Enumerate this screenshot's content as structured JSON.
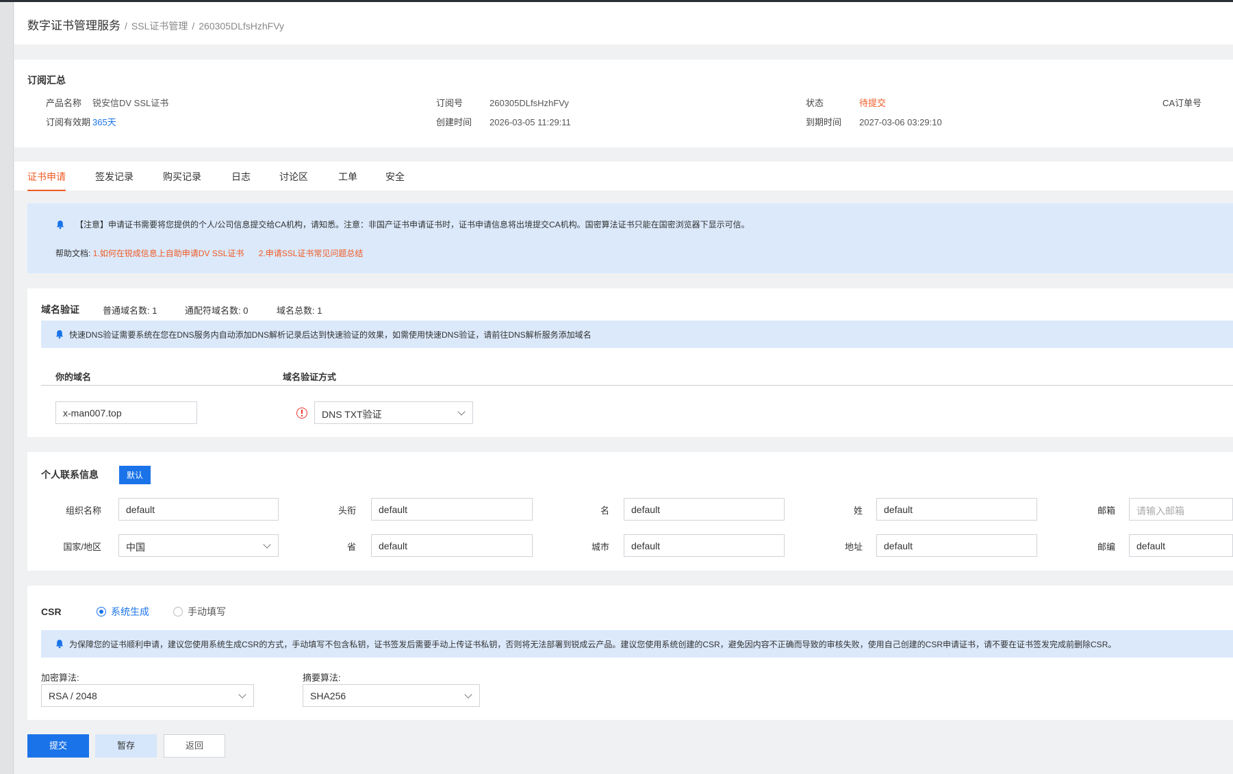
{
  "breadcrumb": {
    "root": "数字证书管理服务",
    "level2": "SSL证书管理",
    "level3": "260305DLfsHzhFVy",
    "separator": "/"
  },
  "summary": {
    "title": "订阅汇总",
    "product_name_label": "产品名称",
    "product_name_value": "锐安信DV SSL证书",
    "validity_label": "订阅有效期",
    "validity_value": "365天",
    "order_no_label": "订阅号",
    "order_no_value": "260305DLfsHzhFVy",
    "created_label": "创建时间",
    "created_value": "2026-03-05 11:29:11",
    "status_label": "状态",
    "status_value": "待提交",
    "expire_label": "到期时间",
    "expire_value": "2027-03-06 03:29:10",
    "ca_order_label": "CA订单号"
  },
  "tabs": [
    {
      "label": "证书申请",
      "active": true
    },
    {
      "label": "签发记录"
    },
    {
      "label": "购买记录"
    },
    {
      "label": "日志"
    },
    {
      "label": "讨论区"
    },
    {
      "label": "工单"
    },
    {
      "label": "安全"
    }
  ],
  "notice": {
    "text": "【注意】申请证书需要将您提供的个人/公司信息提交给CA机构，请知悉。注意：非国产证书申请证书时，证书申请信息将出境提交CA机构。国密算法证书只能在国密浏览器下显示可信。",
    "help_label": "帮助文档:",
    "link1": "1.如何在锐成信息上自助申请DV SSL证书",
    "link2": "2.申请SSL证书常见问题总结"
  },
  "domain_section": {
    "title": "域名验证",
    "normal_count": "普通域名数: 1",
    "wildcard_count": "通配符域名数: 0",
    "total_count": "域名总数: 1",
    "info": "快速DNS验证需要系统在您在DNS服务内自动添加DNS解析记录后达到快速验证的效果，如需使用快速DNS验证，请前往DNS解析服务添加域名",
    "col_domain": "你的域名",
    "col_method": "域名验证方式",
    "domain_value": "x-man007.top",
    "method_value": "DNS TXT验证"
  },
  "contact_section": {
    "title": "个人联系信息",
    "default_badge": "默认",
    "org_label": "组织名称",
    "org_value": "default",
    "title_label": "头衔",
    "title_value": "default",
    "first_label": "名",
    "first_value": "default",
    "last_label": "姓",
    "last_value": "default",
    "email_label": "邮箱",
    "email_placeholder": "请输入邮箱",
    "country_label": "国家/地区",
    "country_value": "中国",
    "province_label": "省",
    "province_value": "default",
    "city_label": "城市",
    "city_value": "default",
    "address_label": "地址",
    "address_value": "default",
    "zip_label": "邮编",
    "zip_value": "default"
  },
  "csr_section": {
    "title": "CSR",
    "option_auto": "系统生成",
    "option_manual": "手动填写",
    "info": "为保障您的证书顺利申请，建议您使用系统生成CSR的方式，手动填写不包含私钥，证书签发后需要手动上传证书私钥，否则将无法部署到锐成云产品。建议您使用系统创建的CSR，避免因内容不正确而导致的审核失败，使用自己创建的CSR申请证书，请不要在证书签发完成前删除CSR。",
    "encrypt_label": "加密算法:",
    "encrypt_value": "RSA / 2048",
    "digest_label": "摘要算法:",
    "digest_value": "SHA256"
  },
  "actions": {
    "submit": "提交",
    "save_draft": "暂存",
    "back": "返回"
  },
  "colors": {
    "accent": "#1a73e8",
    "orange": "#f05a24",
    "info_bg": "#dbe9fb"
  }
}
